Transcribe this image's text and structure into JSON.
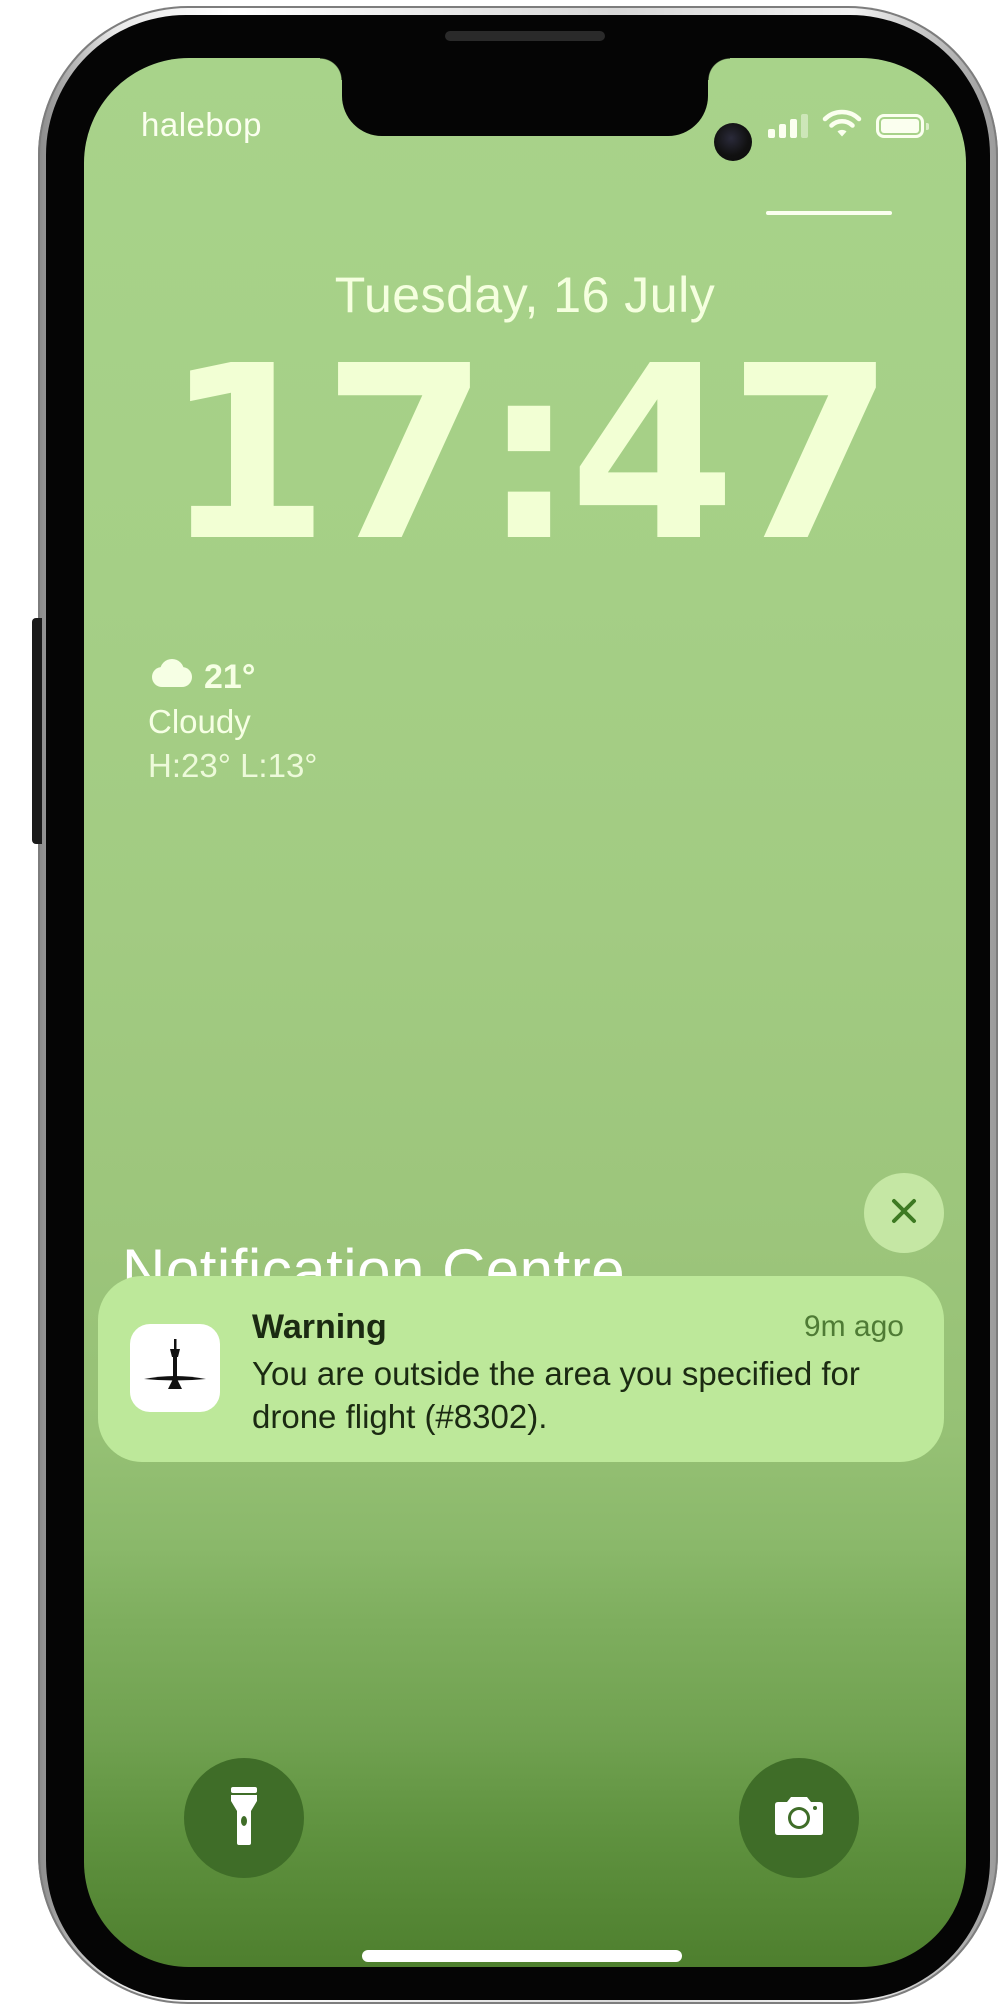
{
  "status_bar": {
    "carrier": "halebop",
    "icons": [
      "cellular-signal-icon",
      "wifi-icon",
      "battery-icon"
    ]
  },
  "lock_screen": {
    "date": "Tuesday, 16 July",
    "time": "17:47"
  },
  "weather": {
    "icon": "cloud-icon",
    "temperature": "21°",
    "condition": "Cloudy",
    "high_low": "H:23° L:13°"
  },
  "notification_centre": {
    "title": "Notification Centre",
    "close_icon": "close-icon"
  },
  "notifications": [
    {
      "app_icon": "drone-control-tower-icon",
      "title": "Warning",
      "time": "9m ago",
      "body": "You are outside the area you specified for drone flight (#8302)."
    }
  ],
  "quick_actions": [
    {
      "name": "flashlight",
      "icon": "flashlight-icon"
    },
    {
      "name": "camera",
      "icon": "camera-icon"
    }
  ],
  "colors": {
    "wallpaper_top": "#a8d38a",
    "wallpaper_bottom": "#4e7f2e",
    "notification_bg": "#bde89a",
    "text_light": "#f2ffd4"
  }
}
